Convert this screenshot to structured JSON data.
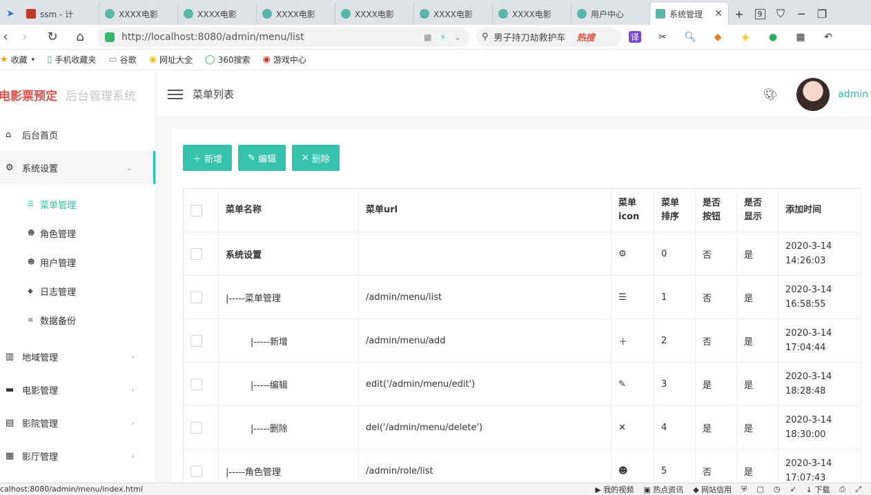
{
  "browser": {
    "tabs": [
      {
        "label": "ssm - 计"
      },
      {
        "label": "XXXX电影"
      },
      {
        "label": "XXXX电影"
      },
      {
        "label": "XXXX电影"
      },
      {
        "label": "XXXX电影"
      },
      {
        "label": "XXXX电影"
      },
      {
        "label": "XXXX电影"
      },
      {
        "label": "用户中心"
      },
      {
        "label": "系统管理"
      }
    ],
    "tab_counter": "9",
    "url": "http://localhost:8080/admin/menu/list",
    "search_text": "男子持刀劫救护车",
    "search_hot": "热搜",
    "bookmarks": [
      "收藏",
      "手机收藏夹",
      "谷歌",
      "网址大全",
      "360搜索",
      "游戏中心"
    ],
    "translate": "译"
  },
  "brand": {
    "name": "电影票预定",
    "sub": "后台管理系统"
  },
  "sidebar": {
    "items": [
      {
        "label": "后台首页",
        "icon": "home-icon"
      },
      {
        "label": "系统设置",
        "icon": "gear-icon"
      },
      {
        "label": "地域管理",
        "icon": "map-icon"
      },
      {
        "label": "电影管理",
        "icon": "film-icon"
      },
      {
        "label": "影院管理",
        "icon": "store-icon"
      },
      {
        "label": "影厅管理",
        "icon": "building-icon"
      }
    ],
    "sub_items": [
      {
        "label": "菜单管理",
        "icon": "list-icon"
      },
      {
        "label": "角色管理",
        "icon": "user-gear-icon"
      },
      {
        "label": "用户管理",
        "icon": "users-icon"
      },
      {
        "label": "日志管理",
        "icon": "tag-icon"
      },
      {
        "label": "数据备份",
        "icon": "database-icon"
      }
    ]
  },
  "header": {
    "title": "菜单列表",
    "username": "admin"
  },
  "toolbar": {
    "add": "新增",
    "edit": "编辑",
    "delete": "删除"
  },
  "table": {
    "columns": [
      "菜单名称",
      "菜单url",
      "菜单icon",
      "菜单排序",
      "是否按钮",
      "是否显示",
      "添加时间"
    ],
    "col_icon_1": "菜单",
    "col_icon_2": "icon",
    "col_sort_1": "菜单",
    "col_sort_2": "排序",
    "col_btn_1": "是否",
    "col_btn_2": "按钮",
    "col_show_1": "是否",
    "col_show_2": "显示",
    "rows": [
      {
        "name": "系统设置",
        "url": "",
        "icon": "gear-icon",
        "sort": "0",
        "button": "否",
        "show": "是",
        "date": "2020-3-14",
        "time": "14:26:03"
      },
      {
        "name": "|-----菜单管理",
        "url": "/admin/menu/list",
        "icon": "list-icon",
        "sort": "1",
        "button": "否",
        "show": "是",
        "date": "2020-3-14",
        "time": "16:58:55"
      },
      {
        "name": "|-----新增",
        "url": "/admin/menu/add",
        "icon": "plus-icon",
        "sort": "2",
        "button": "否",
        "show": "是",
        "date": "2020-3-14",
        "time": "17:04:44"
      },
      {
        "name": "|-----编辑",
        "url": "edit('/admin/menu/edit')",
        "icon": "pencil-icon",
        "sort": "3",
        "button": "是",
        "show": "是",
        "date": "2020-3-14",
        "time": "18:28:48"
      },
      {
        "name": "|-----删除",
        "url": "del('/admin/menu/delete')",
        "icon": "close-icon",
        "sort": "4",
        "button": "是",
        "show": "是",
        "date": "2020-3-14",
        "time": "18:30:00"
      },
      {
        "name": "|-----角色管理",
        "url": "/admin/role/list",
        "icon": "user-gear-icon",
        "sort": "5",
        "button": "否",
        "show": "是",
        "date": "2020-3-14",
        "time": "17:07:43"
      }
    ]
  },
  "statusbar": {
    "url": "calhost:8080/admin/menu/index.html",
    "items": [
      "我的视频",
      "热点资讯",
      "网站信用",
      "下载"
    ]
  }
}
